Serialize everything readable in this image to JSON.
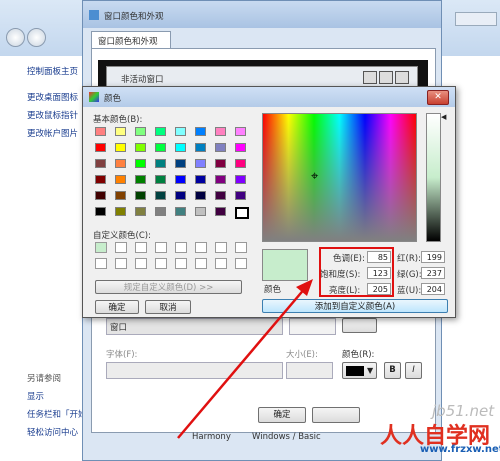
{
  "explorer": {
    "left_links": [
      "控制面板主页",
      "更改桌面图标",
      "更改鼠标指针",
      "更改帐户图片"
    ],
    "see_also_title": "另请参阅",
    "see_also_links": [
      "显示",
      "任务栏和「开始",
      "轻松访问中心"
    ]
  },
  "appearance": {
    "title": "窗口颜色和外观",
    "tab": "窗口颜色和外观",
    "inactive_window": "非活动窗口",
    "item_value": "窗口",
    "font_label": "字体(F):",
    "size_label": "大小(E):",
    "color_label": "颜色(R):",
    "bold_button": "B",
    "italic_button": "I",
    "ok_button": "确定",
    "theme_names": [
      "Harmony",
      "Windows / Basic"
    ]
  },
  "color_dialog": {
    "title": "颜色",
    "basic_colors_label": "基本颜色(B):",
    "custom_colors_label": "自定义颜色(C):",
    "define_custom_button": "规定自定义颜色(D) >>",
    "ok_button": "确定",
    "cancel_button": "取消",
    "color_solid_label": "颜色",
    "add_custom_button": "添加到自定义颜色(A)",
    "hue_label": "色调(E):",
    "hue": "85",
    "sat_label": "饱和度(S):",
    "sat": "123",
    "lum_label": "亮度(L):",
    "lum": "205",
    "red_label": "红(R):",
    "red": "199",
    "green_label": "绿(G):",
    "green": "237",
    "blue_label": "蓝(U):",
    "blue": "204",
    "selected_color": "#c7edcc",
    "basic_colors": [
      "#ff8080",
      "#ffff80",
      "#80ff80",
      "#00ff80",
      "#80ffff",
      "#0080ff",
      "#ff80c0",
      "#ff80ff",
      "#ff0000",
      "#ffff00",
      "#80ff00",
      "#00ff40",
      "#00ffff",
      "#0080c0",
      "#8080c0",
      "#ff00ff",
      "#804040",
      "#ff8040",
      "#00ff00",
      "#008080",
      "#004080",
      "#8080ff",
      "#800040",
      "#ff0080",
      "#800000",
      "#ff8000",
      "#008000",
      "#008040",
      "#0000ff",
      "#0000a0",
      "#800080",
      "#8000ff",
      "#400000",
      "#804000",
      "#004000",
      "#004040",
      "#000080",
      "#000040",
      "#400040",
      "#400080",
      "#000000",
      "#808000",
      "#808040",
      "#808080",
      "#408080",
      "#c0c0c0",
      "#400040",
      "#ffffff"
    ]
  },
  "watermark": {
    "site": "jb51.net",
    "brand": "人人自学网",
    "url": "www.frzxw.net"
  }
}
